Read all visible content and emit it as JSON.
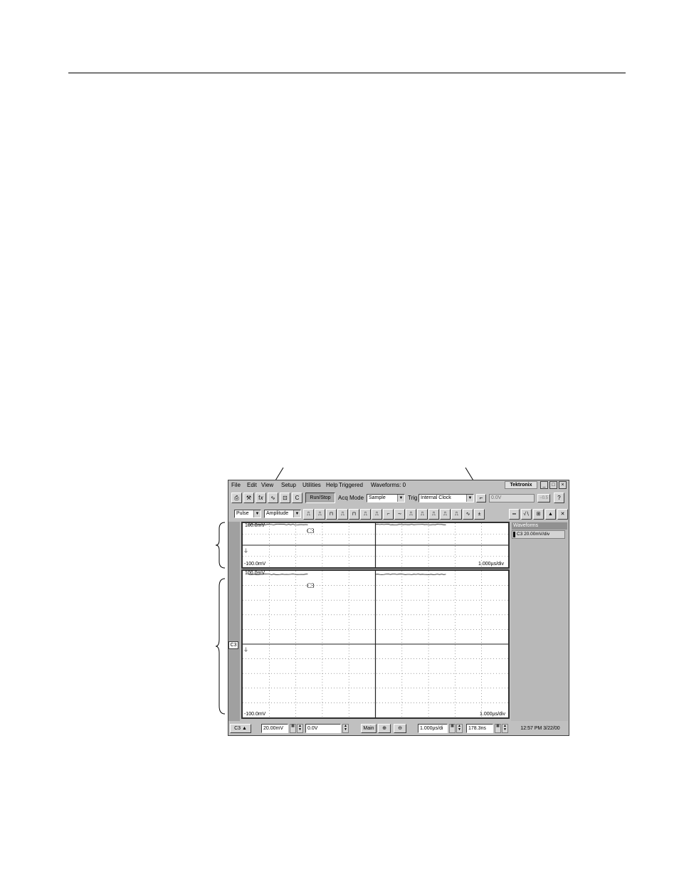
{
  "menu": {
    "items": [
      "File",
      "Edit",
      "View",
      "Setup",
      "Utilities",
      "Help"
    ],
    "status_triggered": "Triggered",
    "status_waveforms": "Waveforms: 0",
    "logo": "Tektronix",
    "minimize": "_",
    "restore": "□",
    "close": "×"
  },
  "toolbar": {
    "icons": [
      "printer-icon",
      "tools-icon",
      "fx-icon",
      "waveform-icon",
      "cursor-icon",
      "clear-icon"
    ],
    "icon_glyphs": [
      "⎙",
      "⚒",
      "f𝑥",
      "∿",
      "⊡",
      "C"
    ],
    "run_stop": "Run/Stop",
    "acq_mode_label": "Acq Mode",
    "acq_mode_value": "Sample",
    "trig_label": "Trig",
    "trig_value": "Internal Clock",
    "trig_level": "0.0V",
    "help_glyph": "?",
    "edge_glyph": "⌐"
  },
  "measure": {
    "category": "Pulse",
    "measurement": "Amplitude",
    "icon_count": 16
  },
  "top_screen": {
    "channel": "C3",
    "top_left": "100.0mV",
    "bottom_left": "-100.0mV",
    "bottom_right": "1.000µs/div"
  },
  "main_screen": {
    "channel": "C3",
    "top_left": "100.0mV",
    "bottom_left": "-100.0mV",
    "bottom_right": "1.000µs/div"
  },
  "side_panel": {
    "title": "Waveforms",
    "item": "C3 20.00mV/div"
  },
  "left_marker": "C3",
  "status": {
    "channel": "C3",
    "volts_div": "20.00mV",
    "offset": "0.0V",
    "main": "Main",
    "time_div": "1.000µs/di",
    "position": "178.3ns",
    "clock": "12:57 PM 3/22/00"
  }
}
